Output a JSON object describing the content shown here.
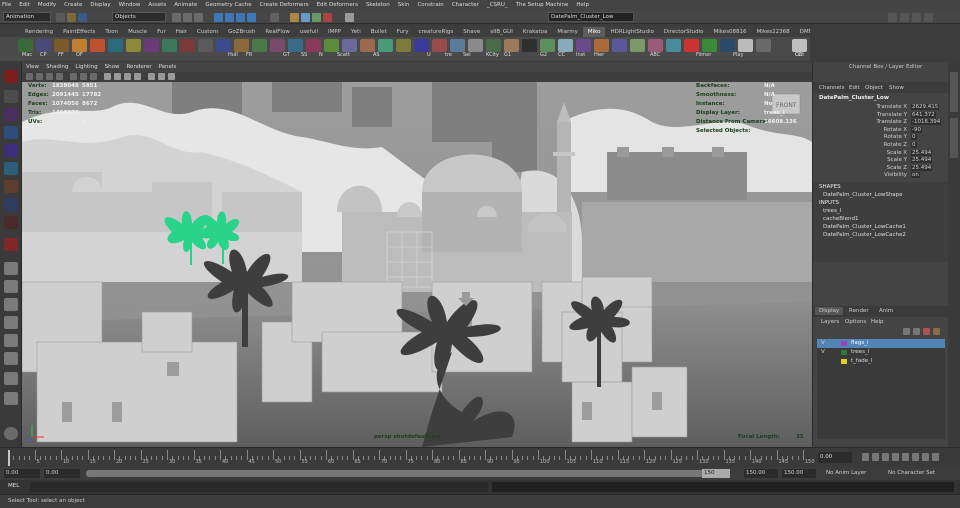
{
  "menu": [
    "File",
    "Edit",
    "Modify",
    "Create",
    "Display",
    "Window",
    "Assets",
    "Animate",
    "Geometry Cache",
    "Create Deformers",
    "Edit Deformers",
    "Skeleton",
    "Skin",
    "Constrain",
    "Character",
    "_CSRU_",
    "The Setup Machine",
    "Help"
  ],
  "status": {
    "mode": "Animation",
    "objects_label": "Objects",
    "search_value": "DatePalm_Cluster_Low"
  },
  "shelf_tabs": [
    "Rendering",
    "PaintEffects",
    "Toon",
    "Muscle",
    "Fur",
    "Hair",
    "Custom",
    "GoZBrush",
    "RealFlow",
    "usefull",
    "IMPP",
    "Yeti",
    "Bullet",
    "Fury",
    "creatureRigs",
    "Shave",
    "sIIB_GUI",
    "Krakatoa",
    "Miarmy",
    "Miko",
    "HDRLightStudio",
    "DirectorStudio",
    "Mikes08816",
    "Mikes22368",
    "DMM"
  ],
  "shelf_active": "Miko",
  "shelf_labels": [
    "Mac",
    "CP",
    "FF",
    "OF",
    "Hull",
    "FR",
    "GT",
    "SS",
    "N",
    "Scatt",
    "AS",
    "U",
    "tre",
    "Sel",
    "KCity",
    "G1",
    "G2",
    "CC",
    "Inst",
    "Hier",
    "ABC",
    "Filmer",
    "Play",
    "Out",
    "CZ"
  ],
  "panel_menu": [
    "View",
    "Shading",
    "Lighting",
    "Show",
    "Renderer",
    "Panels"
  ],
  "hud": {
    "left_labels": [
      "Verts:",
      "Edges:",
      "Faces:",
      "Tris:",
      "UVs:"
    ],
    "col1": [
      "1838048",
      "2091445",
      "1074056",
      "1458072",
      ""
    ],
    "col2": [
      "5851",
      "17782",
      "8672",
      "",
      "0"
    ],
    "right_labels": [
      "Backfaces:",
      "Smoothness:",
      "Instance:",
      "Display Layer:",
      "Distance From Camera:",
      "Selected Objects:"
    ],
    "right_values": [
      "N/A",
      "N/A",
      "No",
      "trees_l",
      "16608.136",
      ""
    ],
    "camera": "persp shotdefault.ma",
    "focal_label": "Focal Length:",
    "focal_value": "35",
    "cube_label": "FRONT"
  },
  "channel_box": {
    "header": "Channel Box / Layer Editor",
    "menu": [
      "Channels",
      "Edit",
      "Object",
      "Show"
    ],
    "object": "DatePalm_Cluster_Low",
    "attrs": [
      {
        "name": "Translate X",
        "value": "2629.415"
      },
      {
        "name": "Translate Y",
        "value": "641.372"
      },
      {
        "name": "Translate Z",
        "value": "-1016.394"
      },
      {
        "name": "Rotate X",
        "value": "-90"
      },
      {
        "name": "Rotate Y",
        "value": "0"
      },
      {
        "name": "Rotate Z",
        "value": "0"
      },
      {
        "name": "Scale X",
        "value": "25.494"
      },
      {
        "name": "Scale Y",
        "value": "25.494"
      },
      {
        "name": "Scale Z",
        "value": "25.494"
      },
      {
        "name": "Visibility",
        "value": "on"
      }
    ],
    "shapes_label": "SHAPES",
    "shapes": [
      "DatePalm_Cluster_LowShape"
    ],
    "inputs_label": "INPUTS",
    "inputs": [
      "trees_l",
      "cacheBlend1",
      "DatePalm_Cluster_LowCache1",
      "DatePalm_Cluster_LowCache2"
    ]
  },
  "layer_editor": {
    "tabs": [
      "Display",
      "Render",
      "Anim"
    ],
    "menu": [
      "Layers",
      "Options",
      "Help"
    ],
    "layers": [
      {
        "v": "V",
        "name": "flags_l",
        "color": "#9a40c0",
        "selected": true
      },
      {
        "v": "V",
        "name": "trees_l",
        "color": "#2e7a3a",
        "selected": false
      },
      {
        "v": "",
        "name": "t_fade_l",
        "color": "#e0d020",
        "selected": false
      }
    ]
  },
  "time": {
    "ticks": [
      "5",
      "10",
      "15",
      "20",
      "25",
      "30",
      "35",
      "40",
      "45",
      "50",
      "55",
      "60",
      "65",
      "70",
      "75",
      "80",
      "85",
      "90",
      "95",
      "100",
      "105",
      "110",
      "115",
      "120",
      "125",
      "130",
      "135",
      "140",
      "145",
      "150"
    ],
    "current": "0.00",
    "range_start": "0.00",
    "range_inner_start": "0.00",
    "range_inner_end": "150",
    "range_end1": "150.00",
    "range_end2": "150.00",
    "anim_layer": "No Anim Layer",
    "char_set": "No Character Set"
  },
  "cmd": {
    "label": "MEL"
  },
  "help": {
    "text": "Select Tool: select an object"
  }
}
